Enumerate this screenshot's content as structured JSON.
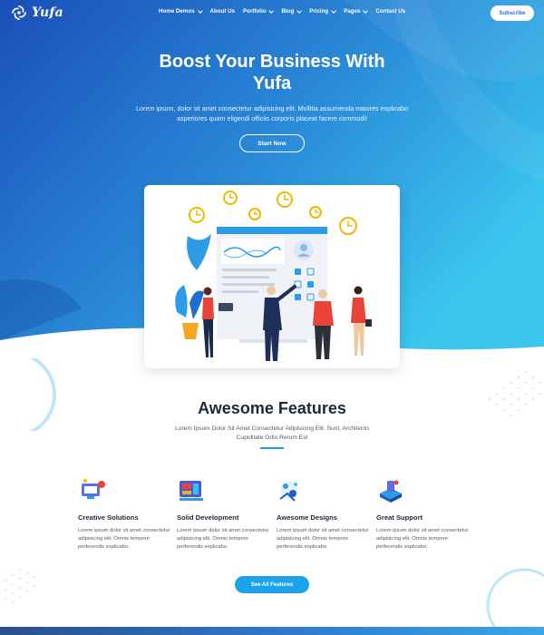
{
  "brand": {
    "name": "Yufa"
  },
  "nav": {
    "items": [
      {
        "label": "Home Demos",
        "dropdown": true
      },
      {
        "label": "About Us",
        "dropdown": false
      },
      {
        "label": "Portfolio",
        "dropdown": true
      },
      {
        "label": "Blog",
        "dropdown": true
      },
      {
        "label": "Pricing",
        "dropdown": true
      },
      {
        "label": "Pages",
        "dropdown": true
      },
      {
        "label": "Contact Us",
        "dropdown": false
      }
    ],
    "subscribe_label": "Subscribe"
  },
  "hero": {
    "title_line1": "Boost Your Business With",
    "title_line2": "Yufa",
    "description": "Lorem ipsum, dolor sit amet consectetur adipisicing elit. Mollitia assumenda maiores explicabo asperiores quam eligendi officiis corporis placeat facere commodi!",
    "cta_label": "Start Now"
  },
  "features": {
    "title": "Awesome Features",
    "subtitle": "Lorem Ipsum Dolor Sit Amet Consectetur Adipisicing Elit. Sunt, Architecto Cupiditate Odio Rerum Est",
    "items": [
      {
        "title": "Creative Solutions",
        "text": "Lorem ipsum dolor sit amet consectetur adipisicing elit. Omnis tempore perferendis explicabo.",
        "icon": "creative-solutions-icon"
      },
      {
        "title": "Solid Development",
        "text": "Lorem ipsum dolor sit amet consectetur adipisicing elit. Omnis tempore perferendis explicabo.",
        "icon": "solid-development-icon"
      },
      {
        "title": "Awesome Designs",
        "text": "Lorem ipsum dolor sit amet consectetur adipisicing elit. Omnis tempore perferendis explicabo.",
        "icon": "awesome-designs-icon"
      },
      {
        "title": "Great Support",
        "text": "Lorem ipsum dolor sit amet consectetur adipisicing elit. Omnis tempore perferendis explicabo.",
        "icon": "great-support-icon"
      }
    ],
    "see_all_label": "See All Features"
  },
  "colors": {
    "hero_start": "#1e5fc4",
    "hero_end": "#36c2ec",
    "accent": "#1aa3e8",
    "heading": "#1c2a3a"
  }
}
